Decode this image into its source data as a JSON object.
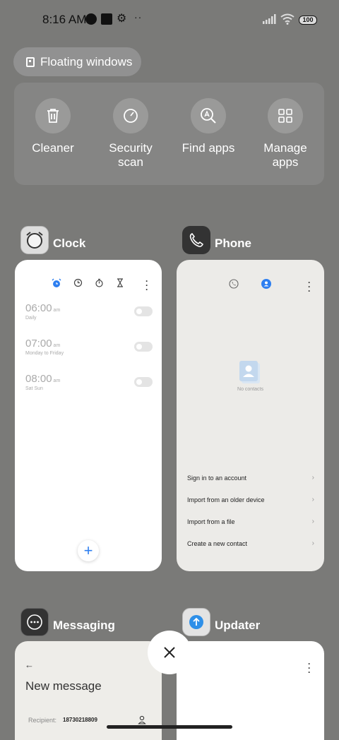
{
  "status_bar": {
    "time": "8:16 AM",
    "battery": "100",
    "icons": [
      "theme-icon",
      "square-icon",
      "gear-icon",
      "more-dots-icon",
      "signal-icon",
      "wifi-icon",
      "battery-icon"
    ]
  },
  "floating_windows": {
    "label": "Floating windows",
    "icon": "floating-window-icon"
  },
  "quick_actions": [
    {
      "label": "Cleaner",
      "icon": "trash-icon"
    },
    {
      "label": "Security scan",
      "icon": "security-scan-icon"
    },
    {
      "label": "Find apps",
      "icon": "find-apps-icon"
    },
    {
      "label": "Manage apps",
      "icon": "grid-icon"
    }
  ],
  "apps": {
    "clock": {
      "name": "Clock",
      "alarms": [
        {
          "time": "06:00",
          "ampm": "am",
          "repeat": "Daily"
        },
        {
          "time": "07:00",
          "ampm": "am",
          "repeat": "Monday to Friday"
        },
        {
          "time": "08:00",
          "ampm": "am",
          "repeat": "Sat Sun"
        }
      ],
      "add_label": "+"
    },
    "phone": {
      "name": "Phone",
      "empty_text": "No contacts",
      "options": [
        "Sign in to an account",
        "Import from an older device",
        "Import from a file",
        "Create a new contact"
      ]
    },
    "messaging": {
      "name": "Messaging",
      "title": "New message",
      "recipient_label": "Recipient:",
      "recipient_value": "18730218809"
    },
    "updater": {
      "name": "Updater"
    }
  },
  "colors": {
    "accent": "#2e7ff0",
    "backdrop": "#7a7a78"
  }
}
